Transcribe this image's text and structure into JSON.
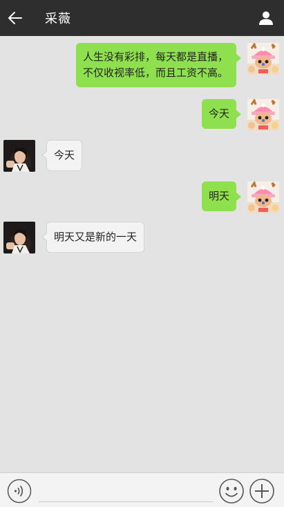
{
  "header": {
    "title": "采薇",
    "back_icon": "back-arrow-icon",
    "profile_icon": "person-icon",
    "bg_color": "#2e2e2e"
  },
  "messages": [
    {
      "sender": "me",
      "text_lines": [
        "人生没有彩排，每天都是直播，",
        "不仅收视率低，而且工资不高。"
      ]
    },
    {
      "sender": "me",
      "text_lines": [
        "今天"
      ]
    },
    {
      "sender": "them",
      "text_lines": [
        "今天"
      ]
    },
    {
      "sender": "me",
      "text_lines": [
        "明天"
      ]
    },
    {
      "sender": "them",
      "text_lines": [
        "明天又是新的一天"
      ]
    }
  ],
  "colors": {
    "me_bubble": "#8fe04f",
    "them_bubble": "#f3f3f3",
    "background": "#e3e3e3"
  },
  "input_bar": {
    "voice_icon": "voice-icon",
    "emoji_icon": "smiley-icon",
    "plus_icon": "plus-icon",
    "text_value": ""
  }
}
